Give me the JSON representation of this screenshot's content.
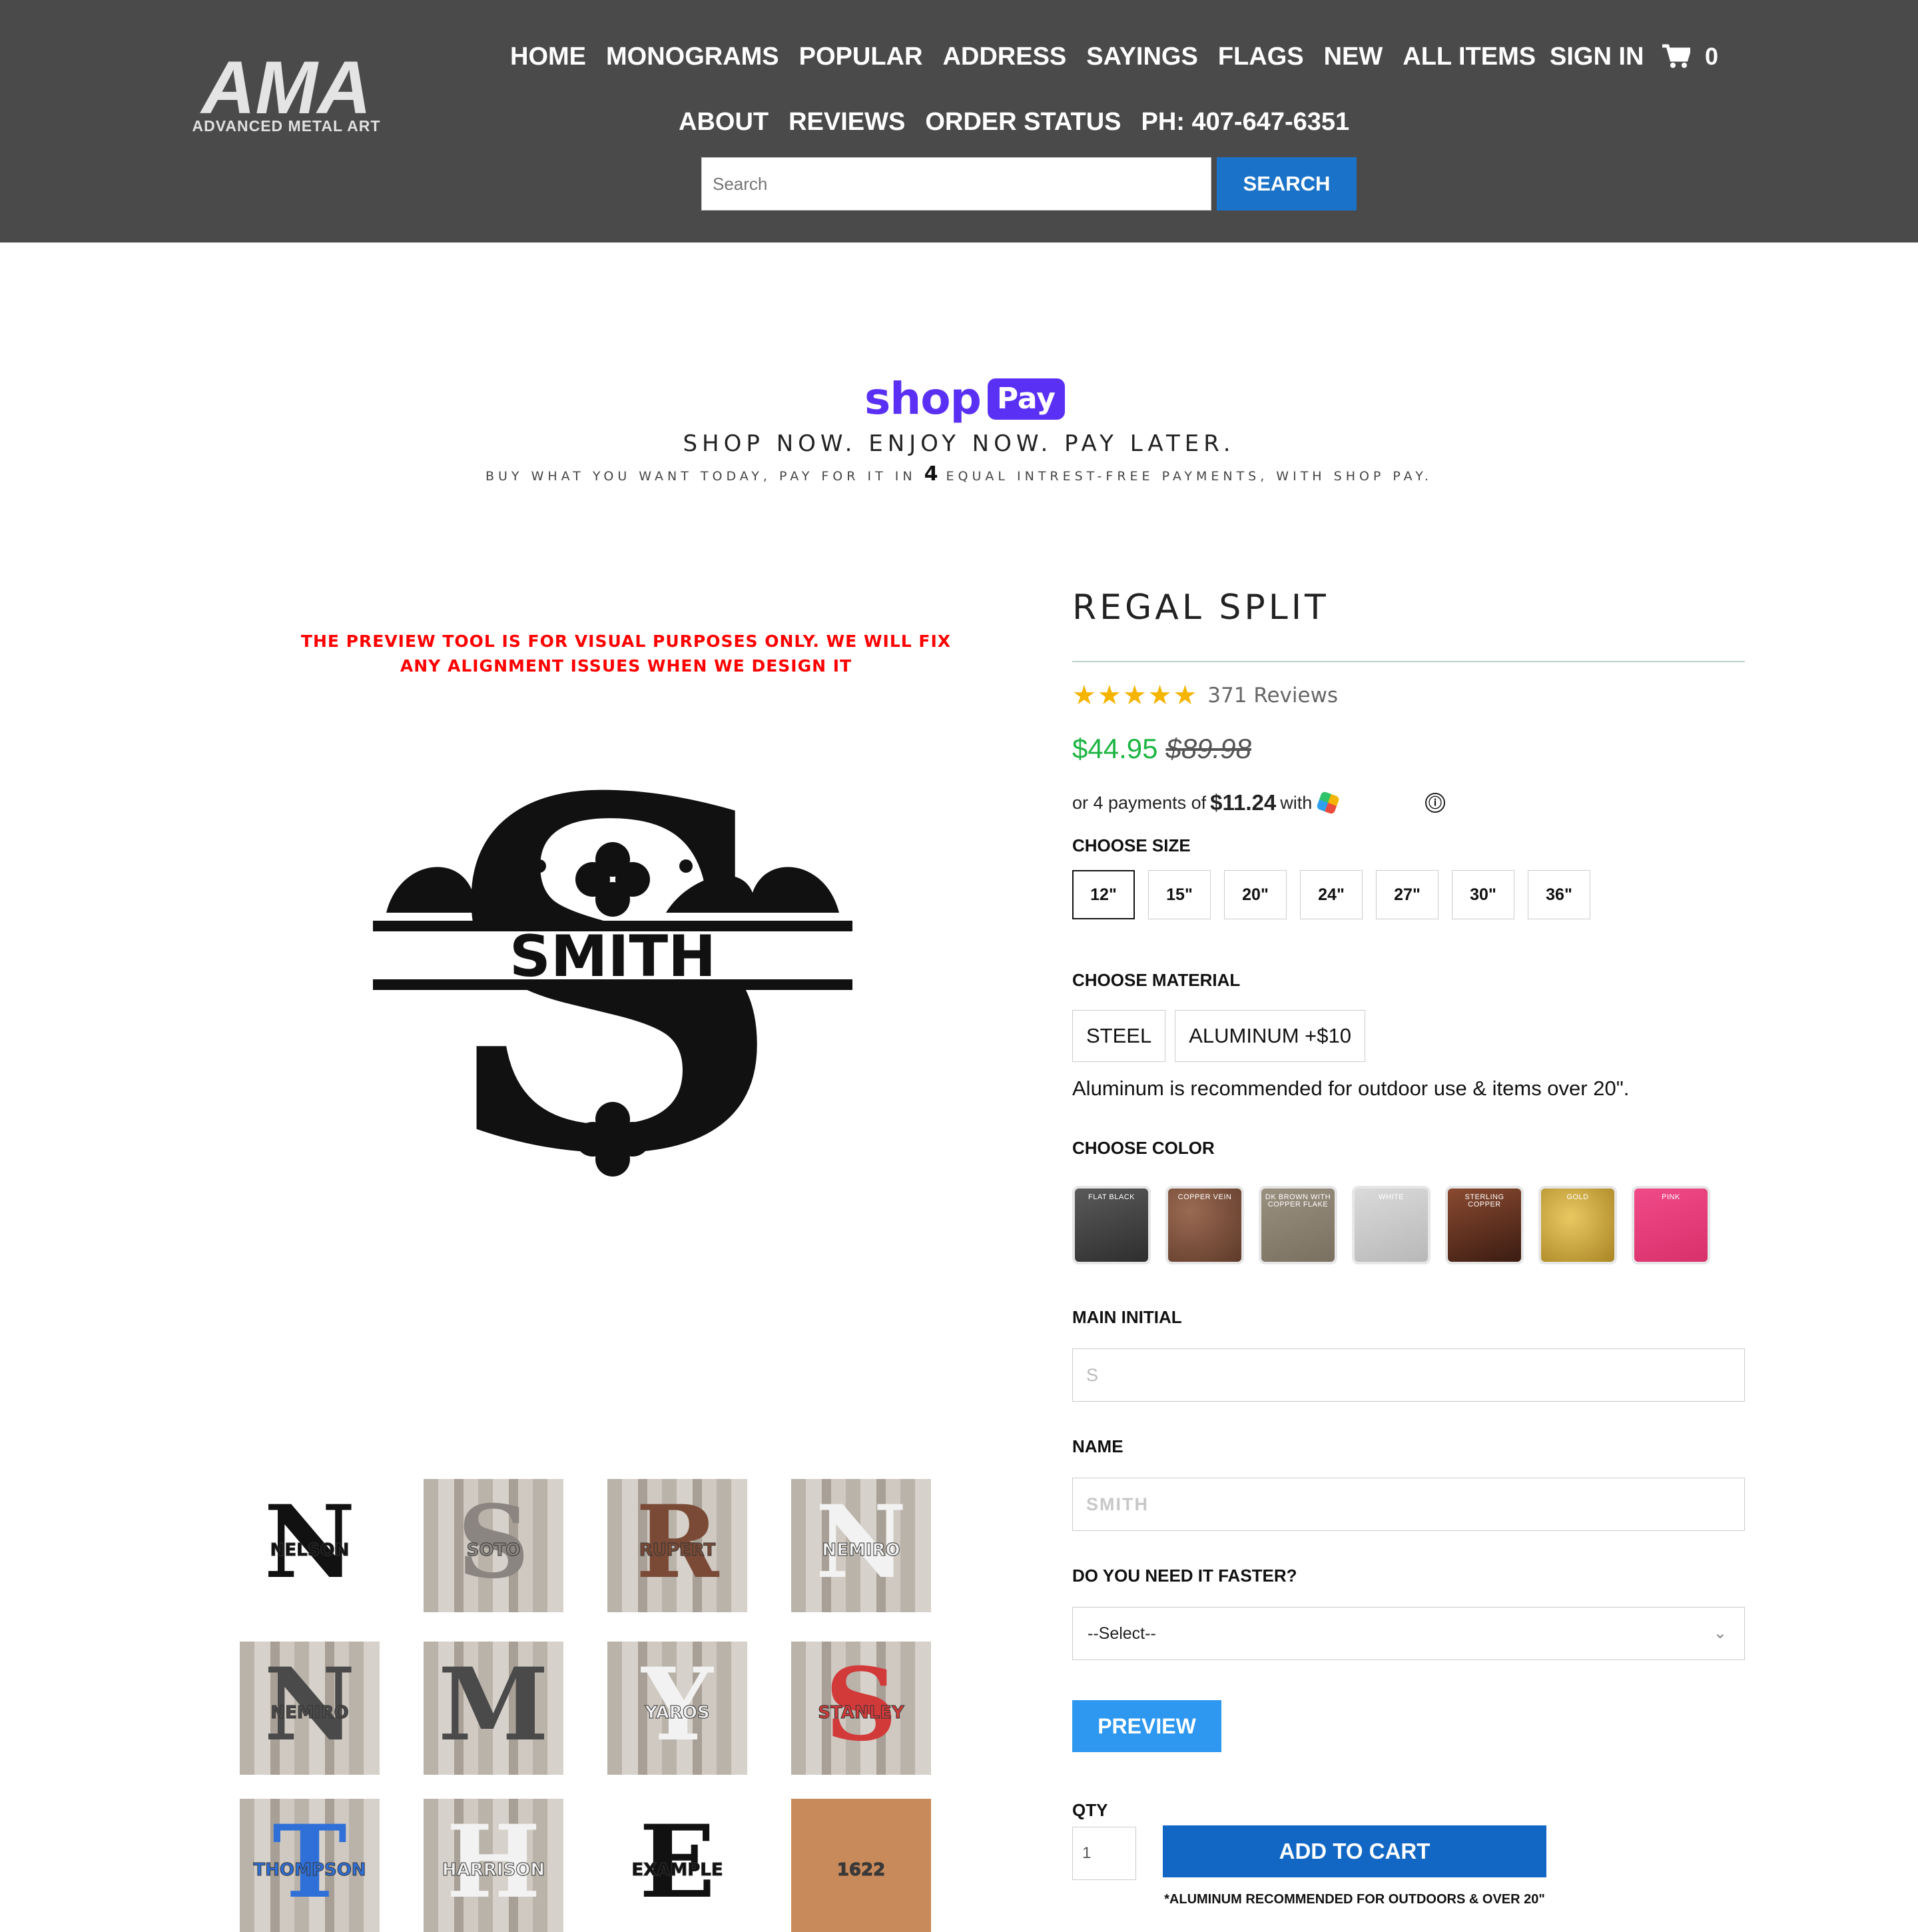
{
  "header": {
    "logo_text": "AMA",
    "logo_subtitle": "ADVANCED METAL ART",
    "nav_row1": [
      "HOME",
      "MONOGRAMS",
      "POPULAR",
      "ADDRESS",
      "SAYINGS",
      "FLAGS",
      "NEW",
      "ALL ITEMS"
    ],
    "nav_row2": [
      "ABOUT",
      "REVIEWS",
      "ORDER STATUS",
      "PH: 407-647-6351"
    ],
    "sign_in": "SIGN IN",
    "cart_count": "0",
    "search_placeholder": "Search",
    "search_button": "SEARCH",
    "bg_color": "#4a4a4a"
  },
  "shoppay": {
    "word": "shop",
    "pill": "Pay",
    "tagline": "SHOP NOW. ENJOY NOW. PAY LATER.",
    "sub_before": "BUY WHAT YOU WANT TODAY, PAY FOR IT IN ",
    "sub_number": "4",
    "sub_after": " EQUAL INTREST-FREE PAYMENTS, WITH SHOP PAY.",
    "brand_color": "#5a31f4"
  },
  "preview": {
    "note_line1": "THE PREVIEW TOOL IS FOR VISUAL PURPOSES ONLY. WE WILL FIX",
    "note_line2": "ANY ALIGNMENT ISSUES WHEN WE DESIGN IT",
    "main_initial": "S",
    "main_name": "SMITH",
    "thumbnails": [
      {
        "initial": "N",
        "name": "NELSON",
        "style": "black-on-white"
      },
      {
        "initial": "S",
        "name": "SOTO",
        "style": "steel-on-wood"
      },
      {
        "initial": "R",
        "name": "RUPERT",
        "style": "copper-on-wood"
      },
      {
        "initial": "N",
        "name": "NEMIRO",
        "style": "white-on-wood"
      },
      {
        "initial": "N",
        "name": "NEMIRO",
        "style": "dark-on-wood"
      },
      {
        "initial": "M",
        "name": "",
        "style": "dark-on-wood"
      },
      {
        "initial": "Y",
        "name": "YAROS",
        "style": "white-on-wood"
      },
      {
        "initial": "S",
        "name": "STANLEY",
        "style": "red-on-wood"
      },
      {
        "initial": "T",
        "name": "THOMPSON",
        "style": "blue-on-wood"
      },
      {
        "initial": "H",
        "name": "HARRISON",
        "style": "white-on-wood"
      },
      {
        "initial": "E",
        "name": "EXAMPLE",
        "style": "black-on-white"
      },
      {
        "initial": "",
        "name": "1622",
        "style": "address-photo"
      }
    ]
  },
  "product": {
    "title": "REGAL SPLIT",
    "rating_stars": 5,
    "reviews": "371 Reviews",
    "price_sale": "$44.95",
    "price_original": "$89.98",
    "installments_before": "or 4 payments of",
    "installments_amount": "$11.24",
    "installments_after": "with",
    "info_icon": "ⓘ",
    "sale_color": "#1db542"
  },
  "options": {
    "size_label": "CHOOSE SIZE",
    "sizes": [
      "12\"",
      "15\"",
      "20\"",
      "24\"",
      "27\"",
      "30\"",
      "36\""
    ],
    "selected_size": "12\"",
    "material_label": "CHOOSE MATERIAL",
    "materials": [
      "STEEL",
      "ALUMINUM +$10"
    ],
    "material_note": "Aluminum is recommended for outdoor use & items over 20\".",
    "color_label": "CHOOSE COLOR",
    "colors": [
      {
        "label": "FLAT BLACK",
        "hex": "#3c3c3c"
      },
      {
        "label": "COPPER VEIN",
        "hex": "#7a4a36"
      },
      {
        "label": "DK BROWN WITH COPPER FLAKE",
        "hex": "#8a8070"
      },
      {
        "label": "WHITE",
        "hex": "#cccccc"
      },
      {
        "label": "STERLING COPPER",
        "hex": "#5e2c1c"
      },
      {
        "label": "GOLD",
        "hex": "#c9a53e"
      },
      {
        "label": "PINK",
        "hex": "#e83c7a"
      }
    ],
    "initial_label": "MAIN INITIAL",
    "initial_placeholder": "S",
    "name_label": "NAME",
    "name_placeholder": "SMITH",
    "faster_label": "DO YOU NEED IT FASTER?",
    "faster_value": "--Select--",
    "preview_button": "PREVIEW",
    "qty_label": "QTY",
    "qty_value": "1",
    "add_to_cart": "ADD TO CART",
    "cart_note": "*ALUMINUM RECOMMENDED FOR OUTDOORS & OVER 20\""
  }
}
